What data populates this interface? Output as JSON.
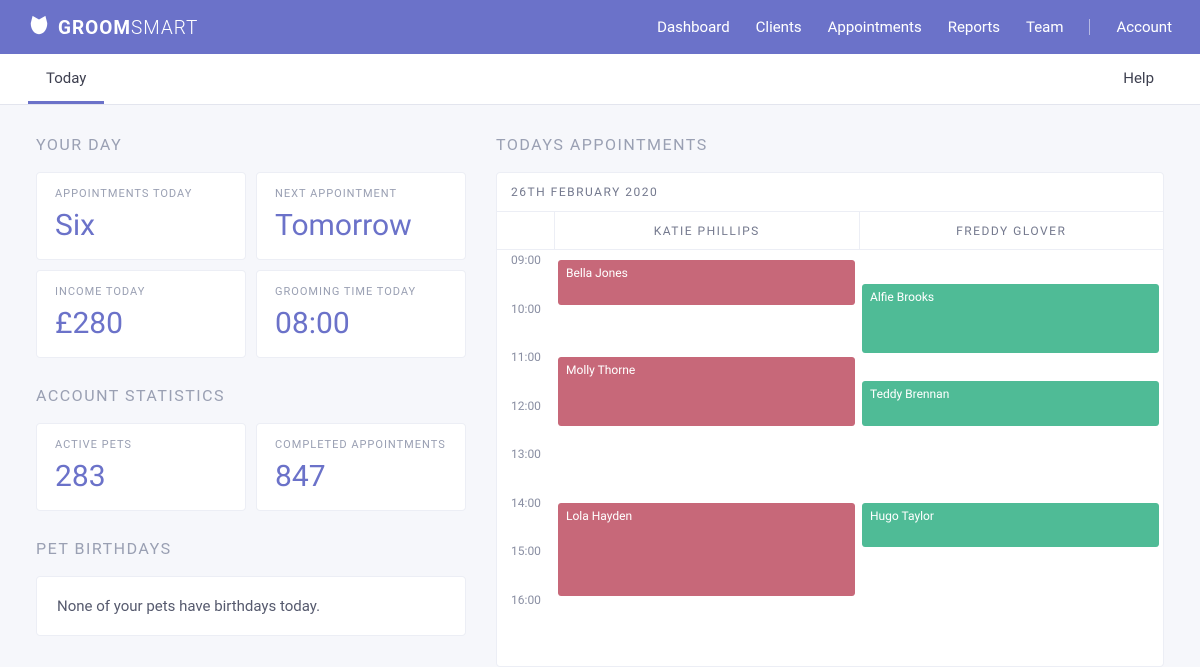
{
  "brand": {
    "bold": "GROOM",
    "light": "SMART"
  },
  "nav": [
    "Dashboard",
    "Clients",
    "Appointments",
    "Reports",
    "Team",
    "Account"
  ],
  "subtabs": {
    "active": "Today",
    "help": "Help"
  },
  "your_day": {
    "title": "YOUR DAY",
    "cards": [
      {
        "label": "APPOINTMENTS TODAY",
        "value": "Six"
      },
      {
        "label": "NEXT APPOINTMENT",
        "value": "Tomorrow"
      },
      {
        "label": "INCOME TODAY",
        "value": "£280"
      },
      {
        "label": "GROOMING TIME TODAY",
        "value": "08:00"
      }
    ]
  },
  "account_stats": {
    "title": "ACCOUNT STATISTICS",
    "cards": [
      {
        "label": "ACTIVE PETS",
        "value": "283"
      },
      {
        "label": "COMPLETED APPOINTMENTS",
        "value": "847"
      }
    ]
  },
  "birthdays": {
    "title": "PET BIRTHDAYS",
    "message": "None of your pets have birthdays today."
  },
  "appointments": {
    "title": "TODAYS APPOINTMENTS",
    "date": "26TH FEBRUARY 2020",
    "groomers": [
      "KATIE PHILLIPS",
      "FREDDY GLOVER"
    ],
    "hours": [
      "09:00",
      "10:00",
      "11:00",
      "12:00",
      "13:00",
      "14:00",
      "15:00",
      "16:00"
    ],
    "hour_start": 9,
    "hour_end": 16,
    "events": [
      {
        "groomer": 0,
        "name": "Bella Jones",
        "start": 9.0,
        "end": 10.0,
        "color": "pink"
      },
      {
        "groomer": 0,
        "name": "Molly Thorne",
        "start": 11.0,
        "end": 12.5,
        "color": "pink"
      },
      {
        "groomer": 0,
        "name": "Lola Hayden",
        "start": 14.0,
        "end": 16.0,
        "color": "pink"
      },
      {
        "groomer": 1,
        "name": "Alfie Brooks",
        "start": 9.5,
        "end": 11.0,
        "color": "green"
      },
      {
        "groomer": 1,
        "name": "Teddy Brennan",
        "start": 11.5,
        "end": 12.5,
        "color": "green"
      },
      {
        "groomer": 1,
        "name": "Hugo Taylor",
        "start": 14.0,
        "end": 15.0,
        "color": "green"
      }
    ]
  }
}
